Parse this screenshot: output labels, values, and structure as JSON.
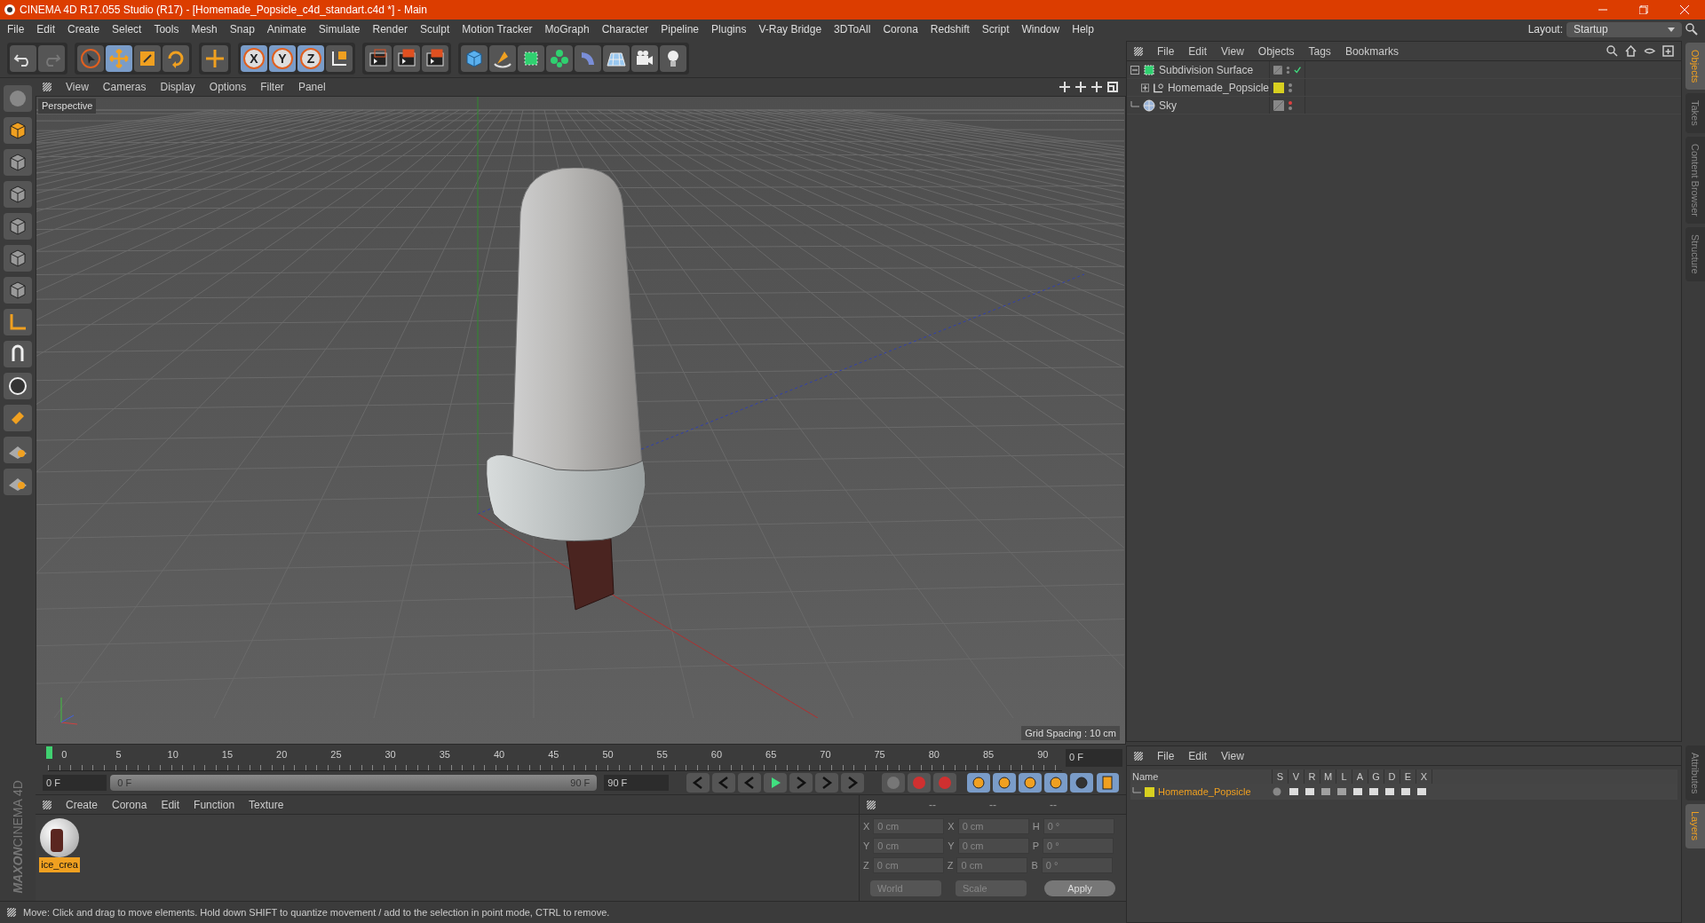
{
  "window": {
    "title": "CINEMA 4D R17.055 Studio (R17) - [Homemade_Popsicle_c4d_standart.c4d *] - Main"
  },
  "menu": [
    "File",
    "Edit",
    "Create",
    "Select",
    "Tools",
    "Mesh",
    "Snap",
    "Animate",
    "Simulate",
    "Render",
    "Sculpt",
    "Motion Tracker",
    "MoGraph",
    "Character",
    "Pipeline",
    "Plugins",
    "V-Ray Bridge",
    "3DToAll",
    "Corona",
    "Redshift",
    "Script",
    "Window",
    "Help"
  ],
  "layout": {
    "label": "Layout:",
    "value": "Startup"
  },
  "axis_buttons": [
    "X",
    "Y",
    "Z"
  ],
  "viewport": {
    "menu": [
      "View",
      "Cameras",
      "Display",
      "Options",
      "Filter",
      "Panel"
    ],
    "label": "Perspective",
    "grid_spacing": "Grid Spacing : 10 cm"
  },
  "timeline": {
    "ticks": [
      "0",
      "5",
      "10",
      "15",
      "20",
      "25",
      "30",
      "35",
      "40",
      "45",
      "50",
      "55",
      "60",
      "65",
      "70",
      "75",
      "80",
      "85",
      "90"
    ],
    "current": "0 F",
    "start": "0 F",
    "range": {
      "start": "0 F",
      "end": "90 F",
      "level": 1
    },
    "end": "90 F"
  },
  "materials": {
    "menu": [
      "Create",
      "Corona",
      "Edit",
      "Function",
      "Texture"
    ],
    "items": [
      {
        "name": "ice_crea",
        "selected": true
      }
    ]
  },
  "coordinates": {
    "headers": [
      "--",
      "--",
      "--"
    ],
    "rows": [
      {
        "axis": "X",
        "position": "0 cm",
        "size_axis": "X",
        "size": "0 cm",
        "rot_axis": "H",
        "rotation": "0 °"
      },
      {
        "axis": "Y",
        "position": "0 cm",
        "size_axis": "Y",
        "size": "0 cm",
        "rot_axis": "P",
        "rotation": "0 °"
      },
      {
        "axis": "Z",
        "position": "0 cm",
        "size_axis": "Z",
        "size": "0 cm",
        "rot_axis": "B",
        "rotation": "0 °"
      }
    ],
    "dropdowns": [
      "World",
      "Scale"
    ],
    "apply": "Apply"
  },
  "status": "Move: Click and drag to move elements. Hold down SHIFT to quantize movement / add to the selection in point mode, CTRL to remove.",
  "logo": [
    "MAXON",
    "CINEMA 4D"
  ],
  "objects": {
    "menu": [
      "File",
      "Edit",
      "View",
      "Objects",
      "Tags",
      "Bookmarks"
    ],
    "items": [
      {
        "name": "Subdivision Surface",
        "kind": "subdivision",
        "expanded": true,
        "children": [
          {
            "name": "Homemade_Popsicle",
            "kind": "null",
            "expanded": false,
            "color": "#d8d020"
          }
        ]
      },
      {
        "name": "Sky",
        "kind": "sky"
      }
    ]
  },
  "layers": {
    "menu": [
      "File",
      "Edit",
      "View"
    ],
    "columns": [
      "Name",
      "S",
      "V",
      "R",
      "M",
      "L",
      "A",
      "G",
      "D",
      "E",
      "X"
    ],
    "rows": [
      {
        "name": "Homemade_Popsicle",
        "color": "#d8d020"
      }
    ]
  },
  "side_tabs": [
    {
      "label": "Objects",
      "selected": true
    },
    {
      "label": "Takes",
      "selected": false
    },
    {
      "label": "Content Browser",
      "selected": false
    },
    {
      "label": "Structure",
      "selected": false
    }
  ],
  "bottom_tabs": [
    {
      "label": "Attributes",
      "selected": false
    },
    {
      "label": "Layers",
      "selected": true
    }
  ]
}
